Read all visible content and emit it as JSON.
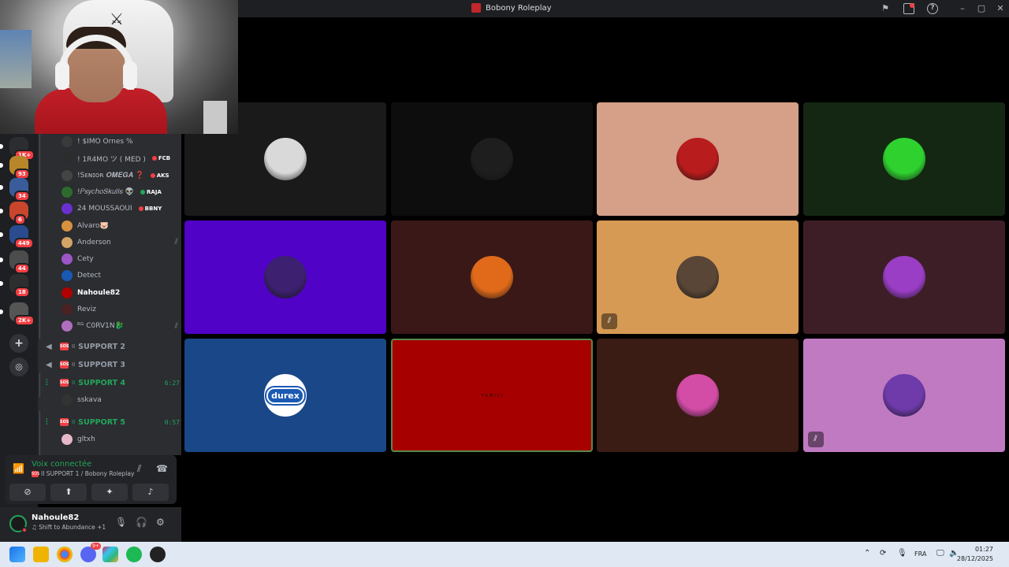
{
  "window": {
    "title": "Bobony Roleplay",
    "icons": [
      "flag-icon",
      "inbox-icon",
      "help-icon",
      "minimize-icon",
      "maximize-icon",
      "close-icon"
    ],
    "help_glyph": "?"
  },
  "rail": {
    "servers": [
      {
        "badge": "1K+",
        "color": "#2b2d31"
      },
      {
        "badge": "93",
        "color": "#b8862a"
      },
      {
        "badge": "34",
        "color": "#3b5c9a"
      },
      {
        "badge": "6",
        "color": "#c7462c"
      },
      {
        "badge": "449",
        "color": "#2a4b8d"
      },
      {
        "badge": "44",
        "color": "#4c4c4c"
      },
      {
        "badge": "18",
        "color": "#2e2e2e"
      },
      {
        "badge": "2K+",
        "color": "#555"
      }
    ],
    "add_label": "+",
    "discover_label": "◎"
  },
  "voice_users_support1": [
    {
      "name": "! $IMO Ornes %",
      "tag": "",
      "color": "#3a3a3a"
    },
    {
      "name": "! 1R4MO ツ ( MED )",
      "tag": "FCB",
      "tag_color": "#f23f43",
      "color": "#2c2c2c"
    },
    {
      "name": "!Sᴇɴɪᴏʀ 𝑶𝑴𝑬𝑮𝑨 ❓",
      "tag": "AKS",
      "tag_color": "#f23f43",
      "color": "#444"
    },
    {
      "name": "!𝑃𝑠𝑦𝑐ℎ𝑜𝑆𝑘𝑢𝑙𝑙𝑠 👽",
      "tag": "RAJA",
      "tag_color": "#23a55a",
      "color": "#2d6b2d"
    },
    {
      "name": "24 MOUSSAOUI",
      "tag": "BBNY",
      "tag_color": "#f23f43",
      "color": "#6a2fd0"
    },
    {
      "name": "Alvaro🐷",
      "tag": "",
      "color": "#d8913e"
    },
    {
      "name": "Anderson",
      "tag": "",
      "color": "#d4a366",
      "muted": true
    },
    {
      "name": "Cety",
      "tag": "",
      "color": "#9b57c7"
    },
    {
      "name": "Detect",
      "tag": "",
      "color": "#1a59b3"
    },
    {
      "name": "Nahoule82",
      "tag": "",
      "color": "#b00000",
      "bold": true
    },
    {
      "name": "Reviz",
      "tag": "",
      "color": "#4a2222"
    },
    {
      "name": "ᴿᴳ C0RV1N🐉",
      "tag": "",
      "color": "#b16ec0",
      "muted": true
    }
  ],
  "voice_channels": [
    {
      "name": "SUPPORT 2",
      "live": false,
      "time": ""
    },
    {
      "name": "SUPPORT 3",
      "live": false,
      "time": ""
    },
    {
      "name": "SUPPORT 4",
      "live": true,
      "time": "6:27"
    },
    {
      "name": "SUPPORT 5",
      "live": true,
      "time": "0:57"
    }
  ],
  "channel_prefix": "II",
  "sos_label": "SOS",
  "support4_user": "sskava",
  "support5_user": "gltxh",
  "voice_panel": {
    "status": "Voix connectée",
    "channel": "II SUPPORT 1 / Bobony Roleplay",
    "buttons": [
      "camera-off-icon",
      "screen-share-icon",
      "activities-icon",
      "soundboard-icon"
    ]
  },
  "user_panel": {
    "username": "Nahoule82",
    "status": "♫ Shift to Abundance +1"
  },
  "tiles": [
    {
      "bg": "#1a1a1a",
      "av": "#d9d9d9",
      "muted": false
    },
    {
      "bg": "#0d0d0d",
      "av": "#1e1e1e",
      "muted": false
    },
    {
      "bg": "#d59f88",
      "av": "#b81c1c",
      "muted": false
    },
    {
      "bg": "#132712",
      "av": "#2fd12f",
      "muted": false
    },
    {
      "bg": "#5002c6",
      "av": "#3d2070",
      "muted": false
    },
    {
      "bg": "#3a1818",
      "av": "#e06a1a",
      "muted": false
    },
    {
      "bg": "#d69a54",
      "av": "#5a4636",
      "muted": true
    },
    {
      "bg": "#3e1e26",
      "av": "#9a3ec6",
      "muted": false
    },
    {
      "bg": "#1a4787",
      "av": "#ffffff",
      "muted": false,
      "logo": "durex"
    },
    {
      "bg": "#a60000",
      "av": "#a60000",
      "muted": false,
      "speaking": true,
      "family": "FAMILY"
    },
    {
      "bg": "#3a1c14",
      "av": "#d34ca6",
      "muted": false
    },
    {
      "bg": "#c07ac2",
      "av": "#6f3aaa",
      "muted": true
    }
  ],
  "taskbar": {
    "language": "FRA",
    "time": "01:27",
    "date": "28/12/2025",
    "discord_badge": "9+"
  }
}
